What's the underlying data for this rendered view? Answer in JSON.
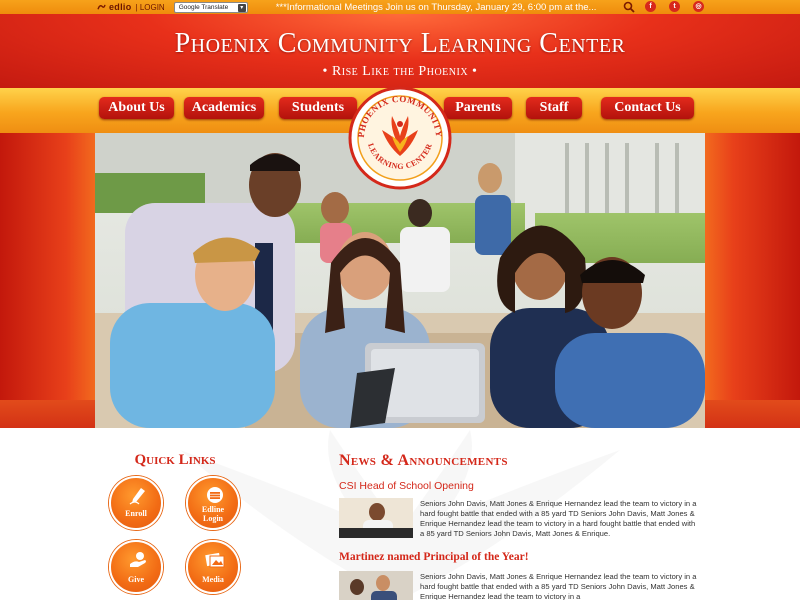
{
  "topbar": {
    "brand": "edlio",
    "login": "| LOGIN",
    "translate": "Google Translate",
    "ticker": "***Informational Meetings Join us on Thursday, January 29, 6:00 pm at the..."
  },
  "header": {
    "title": "Phoenix Community Learning Center",
    "tagline": "• Rise Like the Phoenix •"
  },
  "nav": {
    "items": [
      {
        "label": "About Us"
      },
      {
        "label": "Academics"
      },
      {
        "label": "Students"
      },
      {
        "label": "Parents"
      },
      {
        "label": "Staff"
      },
      {
        "label": "Contact Us"
      }
    ]
  },
  "emblem": {
    "text_top": "PHOENIX COMMUNITY",
    "text_bottom": "LEARNING CENTER"
  },
  "quick_links": {
    "title": "Quick Links",
    "items": [
      {
        "label": "Enroll",
        "icon": "pen-icon"
      },
      {
        "label": "Edline Login",
        "label_line1": "Edline",
        "label_line2": "Login",
        "icon": "edline-icon"
      },
      {
        "label": "Give",
        "icon": "hand-icon"
      },
      {
        "label": "Media",
        "icon": "photos-icon"
      }
    ]
  },
  "news": {
    "title": "News & Announcements",
    "items": [
      {
        "title": "CSI Head of School Opening",
        "text": "Seniors John Davis, Matt Jones & Enrique Hernandez lead the team to victory in a hard fought battle that ended with a 85 yard TD Seniors John Davis, Matt Jones & Enrique Hernandez lead the team to victory in a hard fought battle that ended with a 85 yard TD Seniors John Davis, Matt Jones & Enrique."
      },
      {
        "title": "Martinez named Principal of the Year!",
        "text": "Seniors John Davis, Matt Jones & Enrique Hernandez lead the team to victory in a hard fought battle that ended with a 85 yard TD Seniors John Davis, Matt Jones & Enrique Hernandez lead the team to victory in a"
      }
    ]
  },
  "colors": {
    "brand_red": "#d4281a",
    "header_orange": "#f8a51d",
    "quicklink_orange": "#f26b14"
  }
}
